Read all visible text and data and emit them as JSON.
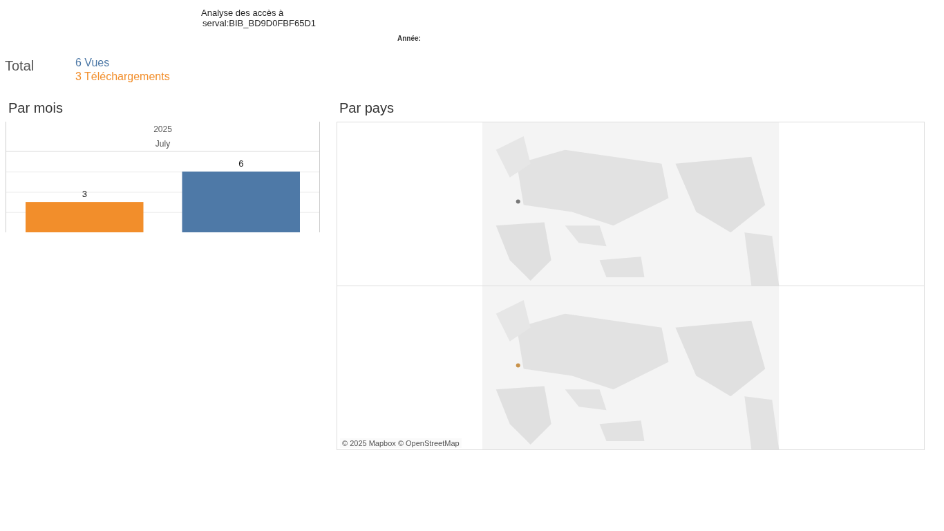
{
  "header": {
    "title": "Analyse des accès à",
    "subtitle": "serval:BIB_BD9D0FBF65D1",
    "year_filter_label": "Année:"
  },
  "total": {
    "label": "Total",
    "items": [
      {
        "text": "6 Vues",
        "color": "#4e79a7"
      },
      {
        "text": "3 Téléchargements",
        "color": "#f28e2b"
      }
    ]
  },
  "monthly": {
    "title": "Par mois",
    "year": "2025",
    "month": "July",
    "chart_data": {
      "type": "bar",
      "categories": [
        null
      ],
      "ylim": [
        0,
        8
      ],
      "data_labels": true,
      "series": [
        {
          "color": "#f28e2b",
          "values": [
            3
          ]
        },
        {
          "color": "#4e79a7",
          "values": [
            6
          ]
        }
      ]
    }
  },
  "countries": {
    "title": "Par pays",
    "attribution": "© 2025 Mapbox © OpenStreetMap"
  }
}
